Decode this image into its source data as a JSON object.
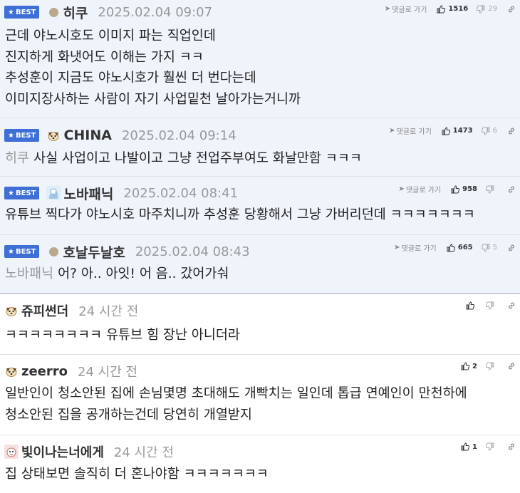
{
  "best_label": "BEST",
  "reply_label": "댓글로 가기",
  "comments": [
    {
      "nick": "히쿠",
      "time": "2025.02.04 09:07",
      "up": "1516",
      "down": "29",
      "lines": [
        "근데 야노시호도 이미지 파는 직업인데",
        "진지하게 화냇어도 이해는 가지 ㅋㅋ",
        "추성훈이 지금도 야노시호가 훨씬 더 번다는데",
        "이미지장사하는 사람이 자기 사업밑천 날아가는거니까"
      ]
    },
    {
      "nick": "CHINA",
      "time": "2025.02.04 09:14",
      "up": "1473",
      "down": "6",
      "mention": "히쿠",
      "lines": [
        "사실 사업이고 나발이고 그냥 전업주부여도 화날만함 ㅋㅋㅋ"
      ]
    },
    {
      "nick": "노바패닉",
      "time": "2025.02.04 08:41",
      "up": "958",
      "down": "",
      "lines": [
        "유튜브 찍다가 야노시호 마주치니까 추성훈 당황해서 그냥 가버리던데 ㅋㅋㅋㅋㅋㅋㅋ"
      ]
    },
    {
      "nick": "호날두날호",
      "time": "2025.02.04 08:43",
      "up": "665",
      "down": "5",
      "mention": "노바패닉",
      "lines": [
        "어? 아.. 아잇! 어 음.. 갔어가숴"
      ]
    },
    {
      "nick": "쥬피썬더",
      "time": "24 시간 전",
      "up": "",
      "down": "",
      "lines": [
        "ㅋㅋㅋㅋㅋㅋㅋㅋ 유튜브 힘 장난 아니더라"
      ]
    },
    {
      "nick": "zeerro",
      "time": "24 시간 전",
      "up": "2",
      "down": "",
      "lines": [
        "일반인이 청소안된 집에 손님몇명 초대해도 개빡치는 일인데 톱급 연예인이 만천하에",
        "청소안된 집을 공개하는건데 당연히 개열받지"
      ]
    },
    {
      "nick": "빛이나는너에게",
      "time": "24 시간 전",
      "up": "1",
      "down": "",
      "lines": [
        "집 상태보면 솔직히 더 혼나야함 ㅋㅋㅋㅋㅋㅋㅋ"
      ]
    }
  ]
}
